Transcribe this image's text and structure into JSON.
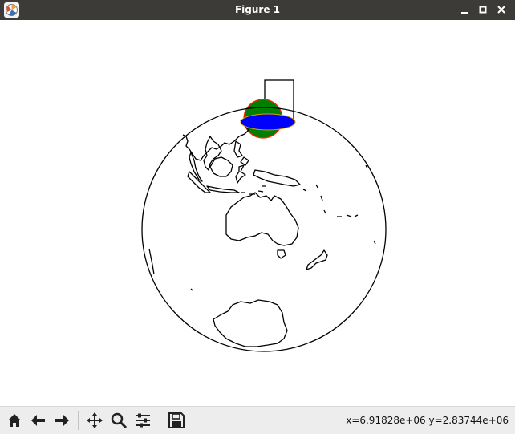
{
  "window": {
    "title": "Figure 1",
    "minimize_icon": "minimize-icon",
    "maximize_icon": "maximize-icon",
    "close_icon": "close-icon"
  },
  "figure": {
    "projection": "orthographic globe",
    "globe_outline_color": "#000000",
    "green_circle_fill": "#008000",
    "green_circle_edge": "#ff0000",
    "blue_ellipse_fill": "#0000ff",
    "rectangle_edge": "#000000"
  },
  "toolbar": {
    "buttons": [
      {
        "name": "home",
        "icon": "home-icon"
      },
      {
        "name": "back",
        "icon": "arrow-left-icon"
      },
      {
        "name": "forward",
        "icon": "arrow-right-icon"
      },
      {
        "name": "pan",
        "icon": "move-icon"
      },
      {
        "name": "zoom",
        "icon": "magnifier-icon"
      },
      {
        "name": "configure",
        "icon": "sliders-icon"
      },
      {
        "name": "save",
        "icon": "floppy-icon"
      }
    ],
    "coordinates": "x=6.91828e+06  y=2.83744e+06"
  }
}
